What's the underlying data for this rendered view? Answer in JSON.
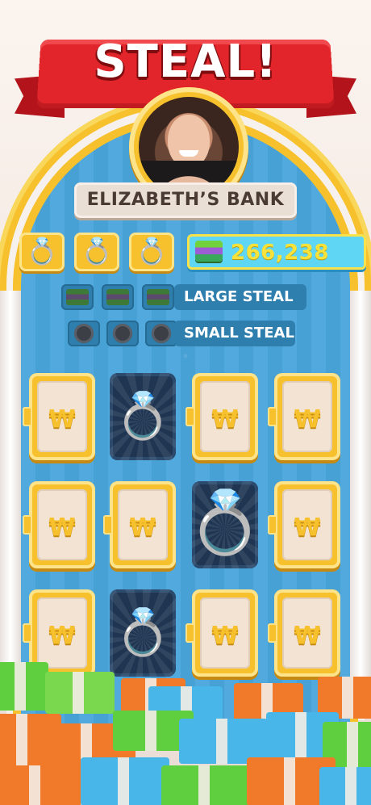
{
  "banner": {
    "title": "STEAL!"
  },
  "bank": {
    "owner_label": "ELIZABETH’S BANK"
  },
  "stats": {
    "ring_slots": [
      "ring-icon",
      "ring-icon",
      "ring-icon"
    ],
    "cash_value": "266,238"
  },
  "steal_options": [
    {
      "label": "LARGE STEAL",
      "slot_icon": "cash-bundle-icon"
    },
    {
      "label": "SMALL STEAL",
      "slot_icon": "coin-icon"
    }
  ],
  "grid": {
    "door_symbol": "₩",
    "cells": [
      {
        "state": "closed"
      },
      {
        "state": "open",
        "reward": "ring"
      },
      {
        "state": "closed"
      },
      {
        "state": "closed"
      },
      {
        "state": "closed"
      },
      {
        "state": "closed"
      },
      {
        "state": "open",
        "reward": "ring",
        "highlight": true
      },
      {
        "state": "closed"
      },
      {
        "state": "closed"
      },
      {
        "state": "open",
        "reward": "ring"
      },
      {
        "state": "closed"
      },
      {
        "state": "closed"
      }
    ]
  },
  "colors": {
    "gold": "#f6c12c",
    "sky": "#4aa6dc",
    "banner_red": "#e2252b",
    "cash_text": "#f6e23a"
  }
}
